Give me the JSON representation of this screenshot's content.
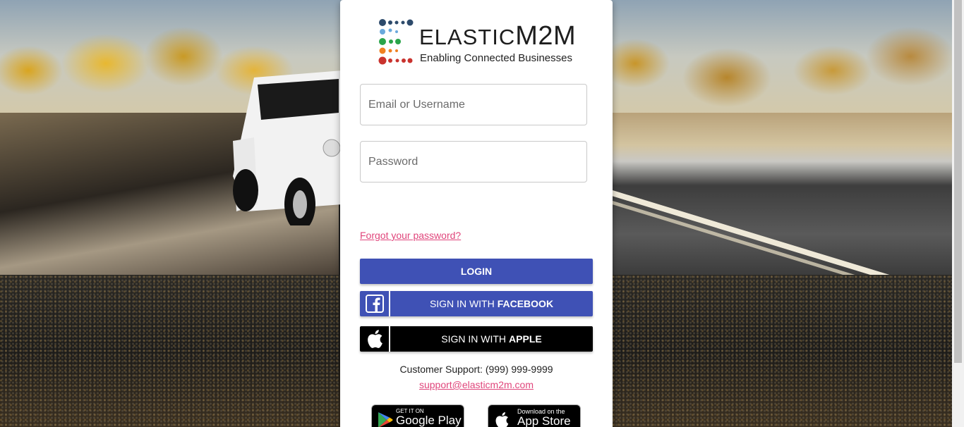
{
  "brand": {
    "name_part1": "ELASTIC",
    "name_part2": "M2M",
    "tagline": "Enabling Connected Businesses"
  },
  "form": {
    "email_placeholder": "Email or Username",
    "password_placeholder": "Password",
    "forgot_link": "Forgot your password?",
    "login_button": "LOGIN",
    "facebook_button_prefix": "SIGN IN WITH",
    "facebook_button_brand": "FACEBOOK",
    "apple_button_prefix": "SIGN IN WITH",
    "apple_button_brand": "APPLE"
  },
  "support": {
    "text": "Customer Support: (999) 999-9999",
    "email": "support@elasticm2m.com"
  },
  "stores": {
    "google_small": "GET IT ON",
    "google_big": "Google Play",
    "apple_small": "Download on the",
    "apple_big": "App Store"
  },
  "colors": {
    "primary": "#3f51b5",
    "link": "#e0457b",
    "apple_button": "#000000"
  },
  "icons": [
    "facebook-icon",
    "apple-icon",
    "google-play-icon"
  ]
}
